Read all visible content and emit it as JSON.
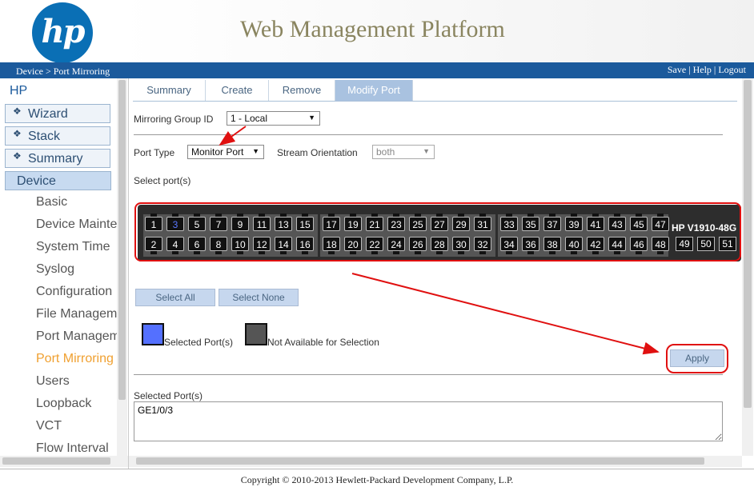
{
  "header": {
    "logo_text": "hp",
    "title": "Web Management Platform"
  },
  "bar": {
    "breadcrumb": "Device > Port Mirroring",
    "links": [
      "Save",
      "Help",
      "Logout"
    ],
    "sep": " | "
  },
  "sidebar": {
    "root": "HP",
    "boxes": [
      "Wizard",
      "Stack",
      "Summary"
    ],
    "device": "Device",
    "items": [
      "Basic",
      "Device Mainten",
      "System Time",
      "Syslog",
      "Configuration",
      "File Manageme",
      "Port Managem",
      "Port Mirroring",
      "Users",
      "Loopback",
      "VCT",
      "Flow Interval"
    ],
    "active_item": "Port Mirroring"
  },
  "tabs": [
    "Summary",
    "Create",
    "Remove",
    "Modify Port"
  ],
  "active_tab": "Modify Port",
  "form": {
    "group_label": "Mirroring Group ID",
    "group_value": "1 - Local",
    "port_type_label": "Port Type",
    "port_type_value": "Monitor Port",
    "orientation_label": "Stream Orientation",
    "orientation_value": "both",
    "select_ports_label": "Select port(s)"
  },
  "switch": {
    "model": "HP V1910-48G",
    "top_ports": [
      "1",
      "3",
      "5",
      "7",
      "9",
      "11",
      "13",
      "15",
      "17",
      "19",
      "21",
      "23",
      "25",
      "27",
      "29",
      "31",
      "33",
      "35",
      "37",
      "39",
      "41",
      "43",
      "45",
      "47"
    ],
    "bottom_ports": [
      "2",
      "4",
      "6",
      "8",
      "10",
      "12",
      "14",
      "16",
      "18",
      "20",
      "22",
      "24",
      "26",
      "28",
      "30",
      "32",
      "34",
      "36",
      "38",
      "40",
      "42",
      "44",
      "46",
      "48"
    ],
    "sfp_ports": [
      "49",
      "50",
      "51"
    ],
    "selected_port": "3"
  },
  "buttons": {
    "select_all": "Select All",
    "select_none": "Select None",
    "apply": "Apply"
  },
  "legend": {
    "selected": "Selected Port(s)",
    "unavailable": "Not Available for Selection",
    "selected_color": "#5470ff",
    "unavailable_color": "#555555"
  },
  "selected_ports": {
    "label": "Selected Port(s)",
    "value": "GE1/0/3"
  },
  "footer": "Copyright © 2010-2013 Hewlett-Packard Development Company, L.P.",
  "colors": {
    "brand_blue": "#1b5a9c",
    "annotation_red": "#e01010",
    "accent_orange": "#f0a030"
  }
}
